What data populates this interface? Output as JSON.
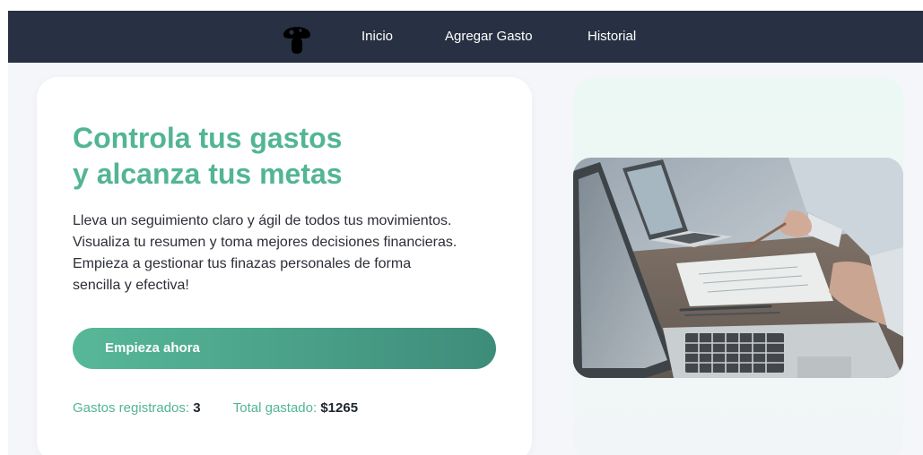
{
  "navbar": {
    "logo_icon": "mushroom-logo-icon",
    "links": [
      {
        "label": "Inicio"
      },
      {
        "label": "Agregar Gasto"
      },
      {
        "label": "Historial"
      }
    ]
  },
  "hero": {
    "title_line1": "Controla tus gastos",
    "title_line2": "y alcanza tus metas",
    "description_lines": [
      "Lleva un seguimiento claro y ágil de todos tus movimientos.",
      "Visualiza tu resumen y toma mejores decisiones financieras.",
      "Empieza a gestionar tus finazas personales de forma",
      "sencilla y efectiva!"
    ],
    "cta_label": "Empieza ahora",
    "stats": {
      "registered_label": "Gastos registrados:",
      "registered_value": "3",
      "total_label": "Total gastado:",
      "total_value": "$1265"
    }
  },
  "image": {
    "subject": "laptops-workspace-photo"
  },
  "colors": {
    "navbar_bg": "#283143",
    "accent": "#52b594",
    "button_gradient_start": "#57b898",
    "button_gradient_end": "#3e8c7a",
    "page_bg": "#f4f6f9"
  }
}
